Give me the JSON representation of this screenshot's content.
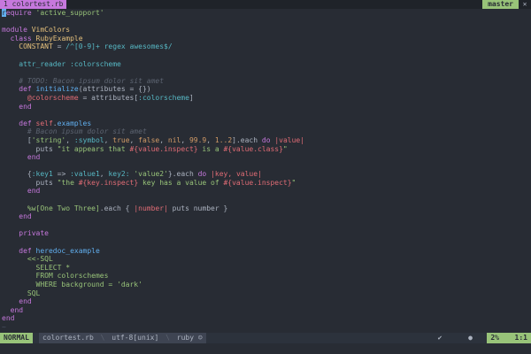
{
  "tabline": {
    "active_tab": "1  colortest.rb",
    "branch": "master",
    "close_icon": "✕"
  },
  "editor": {
    "lines": [
      [
        {
          "t": "r",
          "c": "cursor"
        },
        {
          "t": "equire ",
          "c": "purple"
        },
        {
          "t": "'active_support'",
          "c": "green"
        }
      ],
      [
        {
          "t": "",
          "c": ""
        }
      ],
      [
        {
          "t": "module ",
          "c": "purple"
        },
        {
          "t": "VimColors",
          "c": "yellow"
        }
      ],
      [
        {
          "t": "  class ",
          "c": "purple"
        },
        {
          "t": "RubyExample",
          "c": "yellow"
        }
      ],
      [
        {
          "t": "    CONSTANT ",
          "c": "yellow"
        },
        {
          "t": "= ",
          "c": ""
        },
        {
          "t": "/^[0-9]+ regex awesomes$/",
          "c": "cyan"
        }
      ],
      [
        {
          "t": "",
          "c": ""
        }
      ],
      [
        {
          "t": "    attr_reader ",
          "c": "cyan"
        },
        {
          "t": ":colorscheme",
          "c": "cyan"
        }
      ],
      [
        {
          "t": "",
          "c": ""
        }
      ],
      [
        {
          "t": "    # TODO: Bacon ipsum dolor sit amet",
          "c": "comment"
        }
      ],
      [
        {
          "t": "    def ",
          "c": "purple"
        },
        {
          "t": "initialize",
          "c": "blue"
        },
        {
          "t": "(attributes = {})",
          "c": ""
        }
      ],
      [
        {
          "t": "      @colorscheme ",
          "c": "red"
        },
        {
          "t": "= attributes[",
          "c": ""
        },
        {
          "t": ":colorscheme",
          "c": "cyan"
        },
        {
          "t": "]",
          "c": ""
        }
      ],
      [
        {
          "t": "    end",
          "c": "purple"
        }
      ],
      [
        {
          "t": "",
          "c": ""
        }
      ],
      [
        {
          "t": "    def ",
          "c": "purple"
        },
        {
          "t": "self",
          "c": "red"
        },
        {
          "t": ".",
          "c": ""
        },
        {
          "t": "examples",
          "c": "blue"
        }
      ],
      [
        {
          "t": "      # Bacon ipsum dolor sit amet",
          "c": "comment"
        }
      ],
      [
        {
          "t": "      [",
          "c": ""
        },
        {
          "t": "'string'",
          "c": "green"
        },
        {
          "t": ", ",
          "c": ""
        },
        {
          "t": ":symbol",
          "c": "cyan"
        },
        {
          "t": ", ",
          "c": ""
        },
        {
          "t": "true",
          "c": "orange"
        },
        {
          "t": ", ",
          "c": ""
        },
        {
          "t": "false",
          "c": "orange"
        },
        {
          "t": ", ",
          "c": ""
        },
        {
          "t": "nil",
          "c": "orange"
        },
        {
          "t": ", ",
          "c": ""
        },
        {
          "t": "99.9",
          "c": "orange"
        },
        {
          "t": ", ",
          "c": ""
        },
        {
          "t": "1..2",
          "c": "orange"
        },
        {
          "t": "].each ",
          "c": ""
        },
        {
          "t": "do ",
          "c": "purple"
        },
        {
          "t": "|value|",
          "c": "red"
        }
      ],
      [
        {
          "t": "        puts ",
          "c": ""
        },
        {
          "t": "\"it appears that ",
          "c": "green"
        },
        {
          "t": "#{value.inspect}",
          "c": "red"
        },
        {
          "t": " is a ",
          "c": "green"
        },
        {
          "t": "#{value.class}",
          "c": "red"
        },
        {
          "t": "\"",
          "c": "green"
        }
      ],
      [
        {
          "t": "      end",
          "c": "purple"
        }
      ],
      [
        {
          "t": "",
          "c": ""
        }
      ],
      [
        {
          "t": "      {",
          "c": ""
        },
        {
          "t": ":key1",
          "c": "cyan"
        },
        {
          "t": " => ",
          "c": ""
        },
        {
          "t": ":value1",
          "c": "cyan"
        },
        {
          "t": ", ",
          "c": ""
        },
        {
          "t": "key2:",
          "c": "cyan"
        },
        {
          "t": " ",
          "c": ""
        },
        {
          "t": "'value2'",
          "c": "green"
        },
        {
          "t": "}.each ",
          "c": ""
        },
        {
          "t": "do ",
          "c": "purple"
        },
        {
          "t": "|key, value|",
          "c": "red"
        }
      ],
      [
        {
          "t": "        puts ",
          "c": ""
        },
        {
          "t": "\"the ",
          "c": "green"
        },
        {
          "t": "#{key.inspect}",
          "c": "red"
        },
        {
          "t": " key has a value of ",
          "c": "green"
        },
        {
          "t": "#{value.inspect}",
          "c": "red"
        },
        {
          "t": "\"",
          "c": "green"
        }
      ],
      [
        {
          "t": "      end",
          "c": "purple"
        }
      ],
      [
        {
          "t": "",
          "c": ""
        }
      ],
      [
        {
          "t": "      %w[One Two Three]",
          "c": "green"
        },
        {
          "t": ".each { ",
          "c": ""
        },
        {
          "t": "|number|",
          "c": "red"
        },
        {
          "t": " puts number }",
          "c": ""
        }
      ],
      [
        {
          "t": "    end",
          "c": "purple"
        }
      ],
      [
        {
          "t": "",
          "c": ""
        }
      ],
      [
        {
          "t": "    private",
          "c": "purple"
        }
      ],
      [
        {
          "t": "",
          "c": ""
        }
      ],
      [
        {
          "t": "    def ",
          "c": "purple"
        },
        {
          "t": "heredoc_example",
          "c": "blue"
        }
      ],
      [
        {
          "t": "      <<-SQL",
          "c": "green"
        }
      ],
      [
        {
          "t": "        SELECT *",
          "c": "green"
        }
      ],
      [
        {
          "t": "        FROM colorschemes",
          "c": "green"
        }
      ],
      [
        {
          "t": "        WHERE background = 'dark'",
          "c": "green"
        }
      ],
      [
        {
          "t": "      SQL",
          "c": "green"
        }
      ],
      [
        {
          "t": "    end",
          "c": "purple"
        }
      ],
      [
        {
          "t": "  end",
          "c": "purple"
        }
      ],
      [
        {
          "t": "end",
          "c": "purple"
        }
      ],
      [
        {
          "t": "~",
          "c": "tilde"
        }
      ],
      [
        {
          "t": "~",
          "c": "tilde"
        }
      ],
      [
        {
          "t": "~",
          "c": "tilde"
        }
      ],
      [
        {
          "t": "~",
          "c": "tilde"
        }
      ],
      [
        {
          "t": "~",
          "c": "tilde"
        }
      ]
    ]
  },
  "statusline": {
    "mode": "NORMAL",
    "filename": "colortest.rb",
    "encoding": "utf-8[unix]",
    "filetype": "ruby",
    "filetype_icon": "☺",
    "check_icon": "✔",
    "dots": "● ",
    "percent": "2%",
    "position": "1:1"
  },
  "colors": {
    "background": "#282c34",
    "accent_purple": "#c678dd",
    "accent_green": "#98c379"
  }
}
